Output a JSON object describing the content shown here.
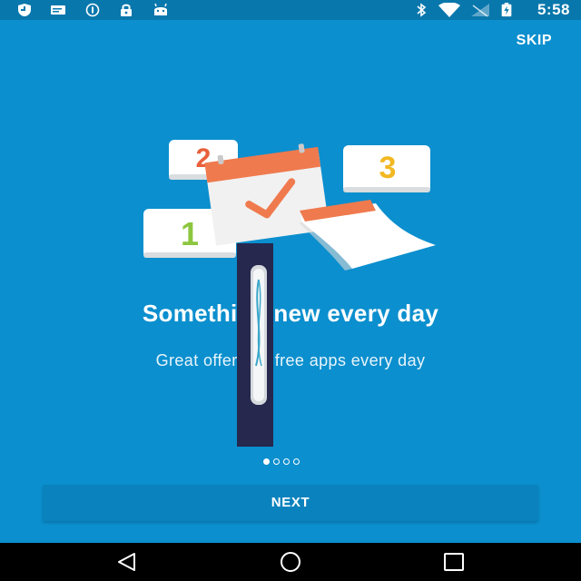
{
  "status_bar": {
    "time": "5:58",
    "left_icons": [
      "shield-icon",
      "message-icon",
      "info-icon",
      "lock-icon",
      "android-icon"
    ],
    "right_icons": [
      "bluetooth-icon",
      "wifi-icon",
      "signal-icon",
      "battery-icon"
    ]
  },
  "header": {
    "skip_label": "SKIP"
  },
  "illustration": {
    "card_numbers": [
      "1",
      "2",
      "3"
    ]
  },
  "content": {
    "title": "Something new every day",
    "subtitle": "Great offers on free apps every day"
  },
  "pager": {
    "total": 4,
    "active_index": 0
  },
  "footer": {
    "next_label": "NEXT"
  },
  "nav_bar": {
    "buttons": [
      "back-icon",
      "home-icon",
      "recents-icon"
    ]
  },
  "colors": {
    "background": "#0b8fce",
    "status_bar": "#0877ac",
    "accent_orange": "#ef7a4e",
    "number_green": "#8dc63f",
    "number_orange": "#e85f3a",
    "number_yellow": "#f2b822"
  }
}
